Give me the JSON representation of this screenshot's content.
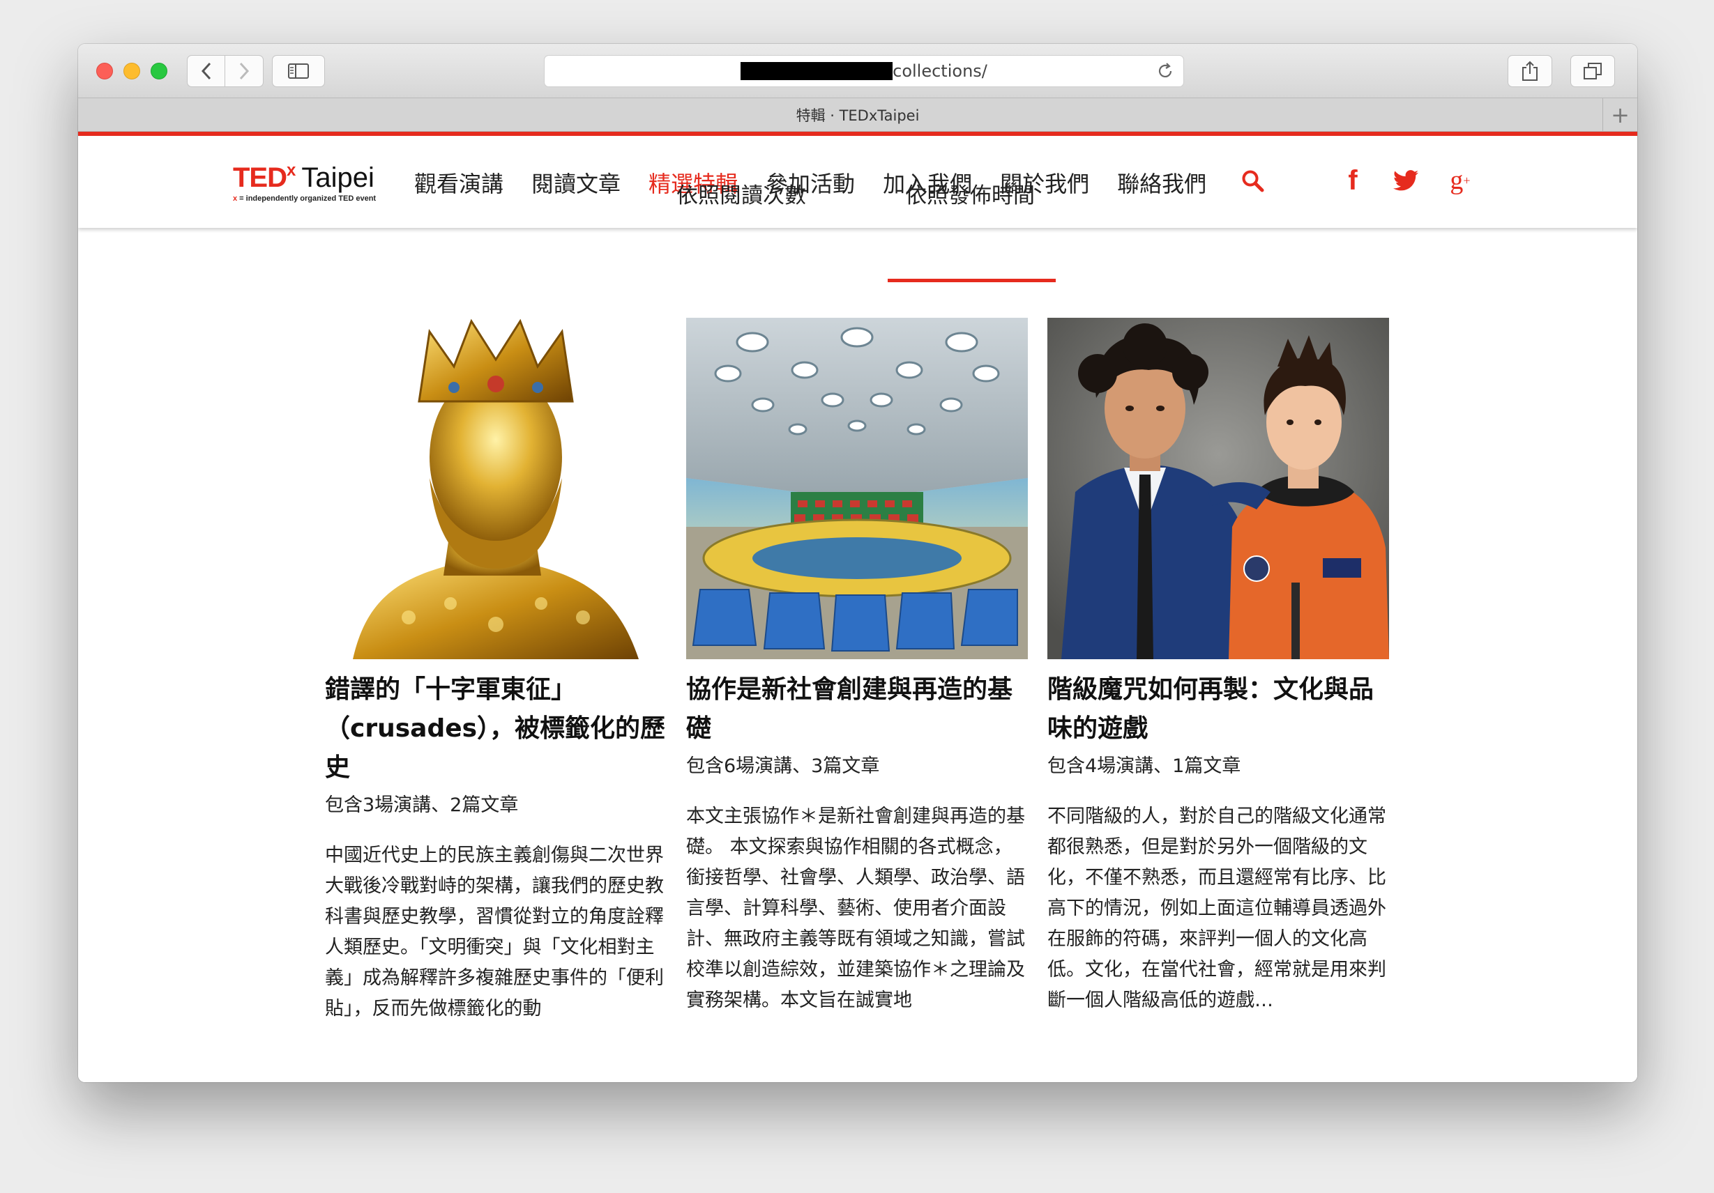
{
  "browser": {
    "url_suffix": "collections/",
    "tab_title": "特輯 · TEDxTaipei",
    "new_tab_label": "+"
  },
  "site": {
    "logo": {
      "ted": "TED",
      "x": "x",
      "city": "Taipei",
      "tagline_x": "x",
      "tagline_rest": " = independently organized TED event"
    },
    "menu": [
      {
        "label": "觀看演講"
      },
      {
        "label": "閱讀文章"
      },
      {
        "label": "精選特輯",
        "active": true
      },
      {
        "label": "參加活動"
      },
      {
        "label": "加入我們"
      },
      {
        "label": "關於我們"
      },
      {
        "label": "聯絡我們"
      }
    ],
    "social": {
      "facebook": "f",
      "google_plus": "g",
      "google_plus_sup": "+"
    },
    "accent_color": "#e62b1e"
  },
  "sort_tabs": {
    "by_views": "依照閱讀次數",
    "by_date": "依照發佈時間",
    "active": "by_date"
  },
  "collections": [
    {
      "image": "golden-crowned-bust",
      "title": "錯譯的「十字軍東征」（crusades），被標籤化的歷史",
      "meta": "包含3場演講、2篇文章",
      "description": "中國近代史上的民族主義創傷與二次世界大戰後冷戰對峙的架構，讓我們的歷史教科書與歷史教學，習慣從對立的角度詮釋人類歷史。「文明衝突」與「文化相對主義」成為解釋許多複雜歷史事件的「便利貼」，反而先做標籤化的動"
    },
    {
      "image": "conference-hall",
      "title": "協作是新社會創建與再造的基礎",
      "meta": "包含6場演講、3篇文章",
      "description": "本文主張協作＊是新社會創建與再造的基礎。 本文探索與協作相關的各式概念，銜接哲學、社會學、人類學、政治學、語言學、計算科學、藝術、使用者介面設計、無政府主義等既有領域之知識，嘗試校準以創造綜效，並建築協作＊之理論及實務架構。本文旨在誠實地"
    },
    {
      "image": "two-men-suit-and-spacesuit",
      "title": "階級魔咒如何再製：文化與品味的遊戲",
      "meta": "包含4場演講、1篇文章",
      "description": "不同階級的人，對於自己的階級文化通常都很熟悉，但是對於另外一個階級的文化，不僅不熟悉，而且還經常有比序、比高下的情況，例如上面這位輔導員透過外在服飾的符碼，來評判一個人的文化高低。文化，在當代社會，經常就是用來判斷一個人階級高低的遊戲…"
    }
  ]
}
